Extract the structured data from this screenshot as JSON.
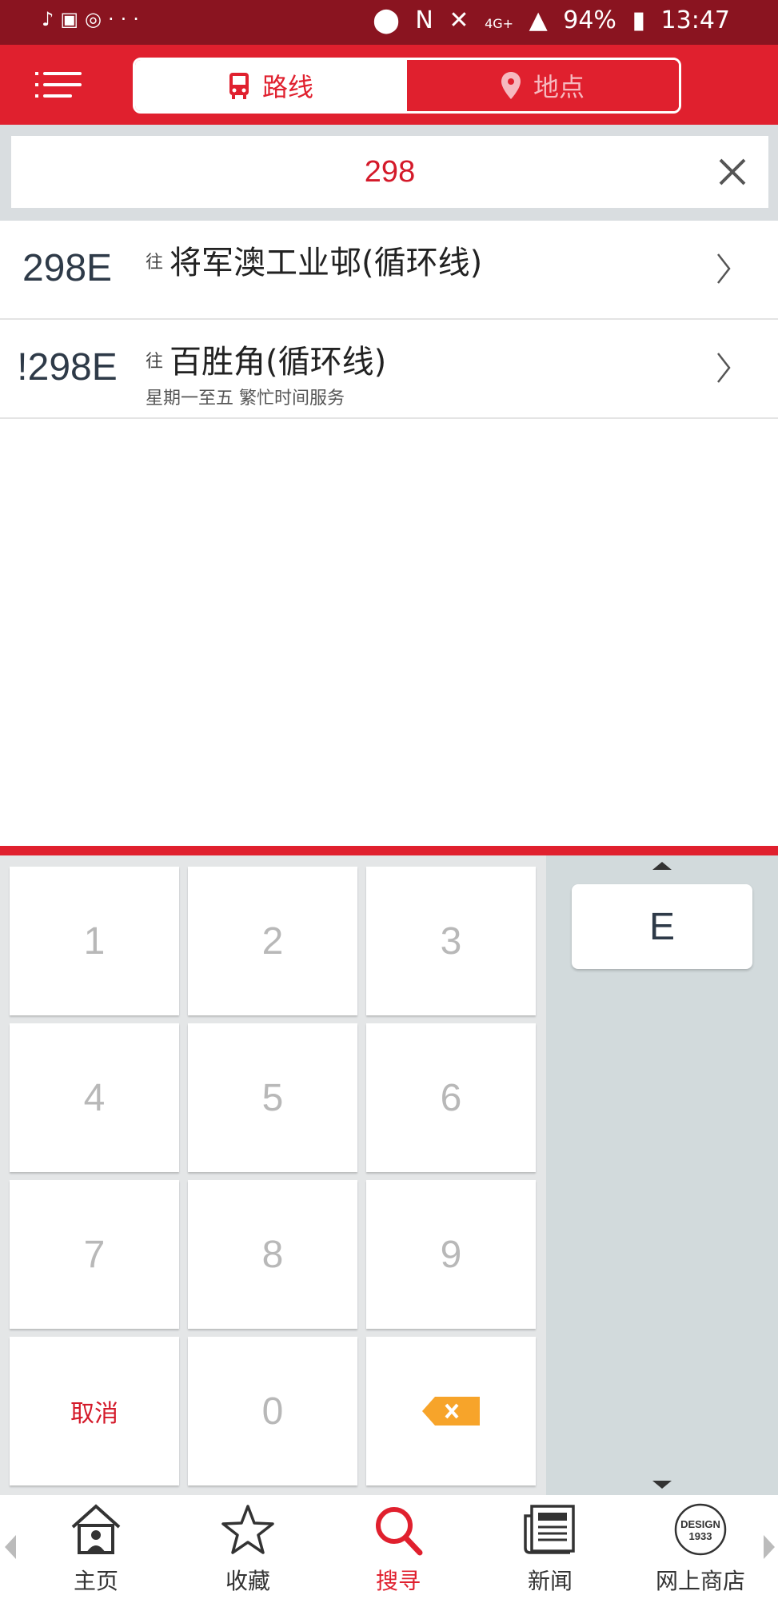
{
  "status_bar": {
    "left_icons": [
      "music-icon",
      "gallery-icon",
      "sync-icon",
      "more-dots-icon"
    ],
    "more": "···",
    "battery": "94%",
    "network": "4G+",
    "time": "13:47"
  },
  "header": {
    "tabs": [
      {
        "label": "路线",
        "icon": "bus-icon",
        "active": true
      },
      {
        "label": "地点",
        "icon": "location-pin-icon",
        "active": false
      }
    ]
  },
  "search": {
    "value": "298"
  },
  "results": [
    {
      "route": "298E",
      "to_prefix": "往",
      "destination": "将军澳工业邨(循环线)",
      "note": ""
    },
    {
      "route": "!298E",
      "to_prefix": "往",
      "destination": "百胜角(循环线)",
      "note": "星期一至五 繁忙时间服务"
    }
  ],
  "keypad": {
    "keys": [
      "1",
      "2",
      "3",
      "4",
      "5",
      "6",
      "7",
      "8",
      "9",
      "取消",
      "0"
    ],
    "cancel_label": "取消",
    "letters": [
      "E"
    ]
  },
  "colors": {
    "brand_red": "#e0202e",
    "status_bar": "#8a1420"
  },
  "bottom_nav": [
    {
      "label": "主页",
      "icon": "home-icon"
    },
    {
      "label": "收藏",
      "icon": "star-icon"
    },
    {
      "label": "搜寻",
      "icon": "search-icon",
      "active": true
    },
    {
      "label": "新闻",
      "icon": "newspaper-icon"
    },
    {
      "label": "网上商店",
      "icon": "design-1933-logo",
      "logo_text": [
        "DESIGN",
        "1933"
      ]
    }
  ]
}
